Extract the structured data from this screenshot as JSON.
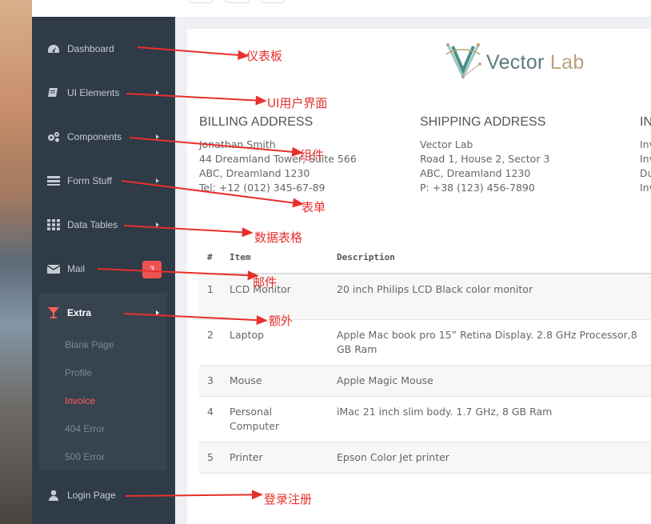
{
  "sidebar": {
    "items": [
      {
        "label": "Dashboard",
        "icon": "dashboard-icon"
      },
      {
        "label": "UI Elements",
        "icon": "book-icon"
      },
      {
        "label": "Components",
        "icon": "gears-icon"
      },
      {
        "label": "Form Stuff",
        "icon": "form-icon"
      },
      {
        "label": "Data Tables",
        "icon": "grid-icon"
      },
      {
        "label": "Mail",
        "icon": "envelope-icon",
        "badge": "3"
      },
      {
        "label": "Extra",
        "icon": "glass-icon"
      },
      {
        "label": "Login Page",
        "icon": "user-icon"
      }
    ],
    "extra_sub": [
      "Blank Page",
      "Profile",
      "Invoice",
      "404 Error",
      "500 Error"
    ]
  },
  "logo": {
    "text_main": "Vector ",
    "text_accent": "Lab"
  },
  "billing": {
    "heading": "BILLING ADDRESS",
    "lines": [
      "Jonathan Smith",
      "44 Dreamland Tower, Suite 566",
      "ABC, Dreamland 1230",
      "Tel: +12 (012) 345-67-89"
    ]
  },
  "shipping": {
    "heading": "SHIPPING ADDRESS",
    "lines": [
      "Vector Lab",
      "Road 1, House 2, Sector 3",
      "ABC, Dreamland 1230",
      "P: +38 (123) 456-7890"
    ]
  },
  "invoice_info": {
    "heading": "IN",
    "lines": [
      "Inv",
      "Inv",
      "Du",
      "Inv"
    ]
  },
  "table": {
    "headers": [
      "#",
      "Item",
      "Description"
    ],
    "rows": [
      {
        "num": "1",
        "item": "LCD Monitor",
        "desc": "20 inch Philips LCD Black color monitor"
      },
      {
        "num": "2",
        "item": "Laptop",
        "desc": "Apple Mac book pro 15” Retina Display. 2.8 GHz Processor,8 GB Ram"
      },
      {
        "num": "3",
        "item": "Mouse",
        "desc": "Apple Magic Mouse"
      },
      {
        "num": "4",
        "item": "Personal Computer",
        "desc": "iMac 21 inch slim body. 1.7 GHz, 8 GB Ram"
      },
      {
        "num": "5",
        "item": "Printer",
        "desc": "Epson Color Jet printer"
      }
    ]
  },
  "annotations": [
    "仪表板",
    "UI用户界面",
    "组件",
    "表单",
    "数据表格",
    "邮件",
    "额外",
    "登录注册"
  ],
  "colors": {
    "sidebar": "#2f3b47",
    "accent": "#ff5e5b",
    "annotation": "#e8302c"
  }
}
